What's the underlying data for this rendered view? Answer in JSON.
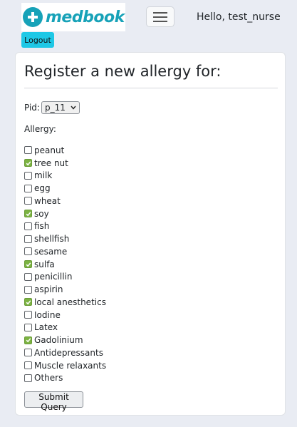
{
  "navbar": {
    "brand": "medbook",
    "greeting": "Hello, test_nurse",
    "logout_label": "Logout",
    "brand_color": "#17a2b8",
    "logout_color": "#1ec8e6"
  },
  "form": {
    "title": "Register a new allergy for:",
    "pid_label": "Pid:",
    "pid_value": "p_11",
    "allergy_label": "Allergy:",
    "submit_label": "Submit Query",
    "check_color": "#7cb342",
    "allergies": [
      {
        "label": "peanut",
        "checked": false
      },
      {
        "label": "tree nut",
        "checked": true
      },
      {
        "label": "milk",
        "checked": false
      },
      {
        "label": "egg",
        "checked": false
      },
      {
        "label": "wheat",
        "checked": false
      },
      {
        "label": "soy",
        "checked": true
      },
      {
        "label": "fish",
        "checked": false
      },
      {
        "label": "shellfish",
        "checked": false
      },
      {
        "label": "sesame",
        "checked": false
      },
      {
        "label": "sulfa",
        "checked": true
      },
      {
        "label": "penicillin",
        "checked": false
      },
      {
        "label": "aspirin",
        "checked": false
      },
      {
        "label": "local anesthetics",
        "checked": true
      },
      {
        "label": "Iodine",
        "checked": false
      },
      {
        "label": "Latex",
        "checked": false
      },
      {
        "label": "Gadolinium",
        "checked": true
      },
      {
        "label": "Antidepressants",
        "checked": false
      },
      {
        "label": "Muscle relaxants",
        "checked": false
      },
      {
        "label": "Others",
        "checked": false
      }
    ]
  }
}
